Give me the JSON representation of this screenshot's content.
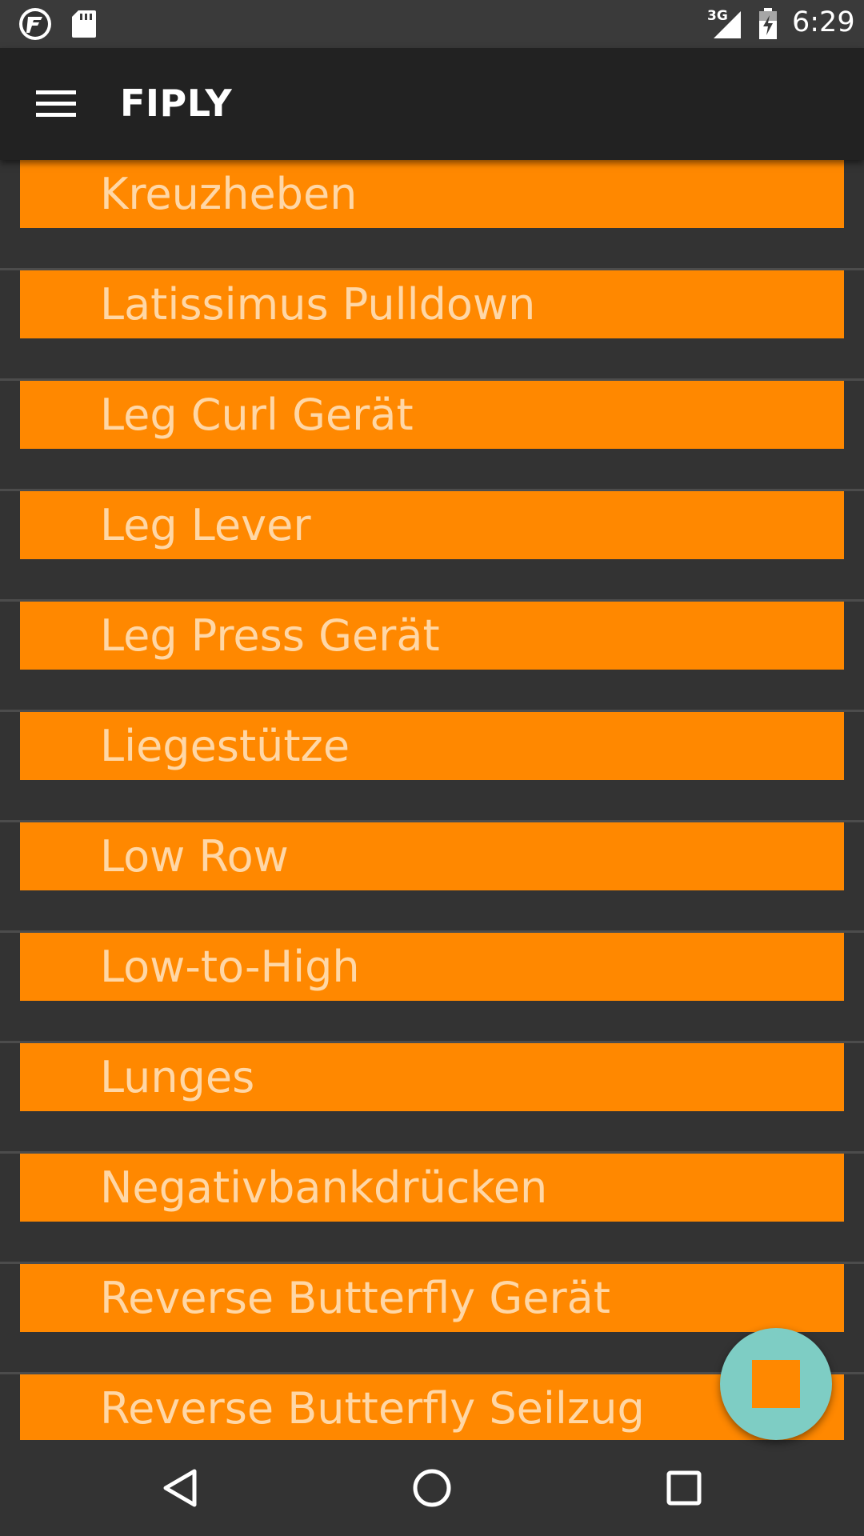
{
  "status_bar": {
    "network": "3G",
    "time": "6:29",
    "icons": [
      "app-logo-icon",
      "sd-card-icon",
      "signal-icon",
      "battery-icon"
    ]
  },
  "app_bar": {
    "title": "FIPLY",
    "menu_icon": "hamburger-menu-icon"
  },
  "colors": {
    "accent": "#ff8800",
    "item_text": "#ffd7a6",
    "background": "#333333",
    "app_bar": "#222222",
    "fab": "#7ecdc4"
  },
  "exercises": [
    "Kreuzheben",
    "Latissimus Pulldown",
    "Leg Curl Gerät",
    "Leg Lever",
    "Leg Press Gerät",
    "Liegestütze",
    "Low Row",
    "Low-to-High",
    "Lunges",
    "Negativbankdrücken",
    "Reverse Butterfly Gerät",
    "Reverse Butterfly Seilzug"
  ],
  "fab": {
    "icon": "stop-square-icon"
  },
  "nav_bar": {
    "icons": [
      "back-triangle-icon",
      "home-circle-icon",
      "recents-square-icon"
    ]
  }
}
